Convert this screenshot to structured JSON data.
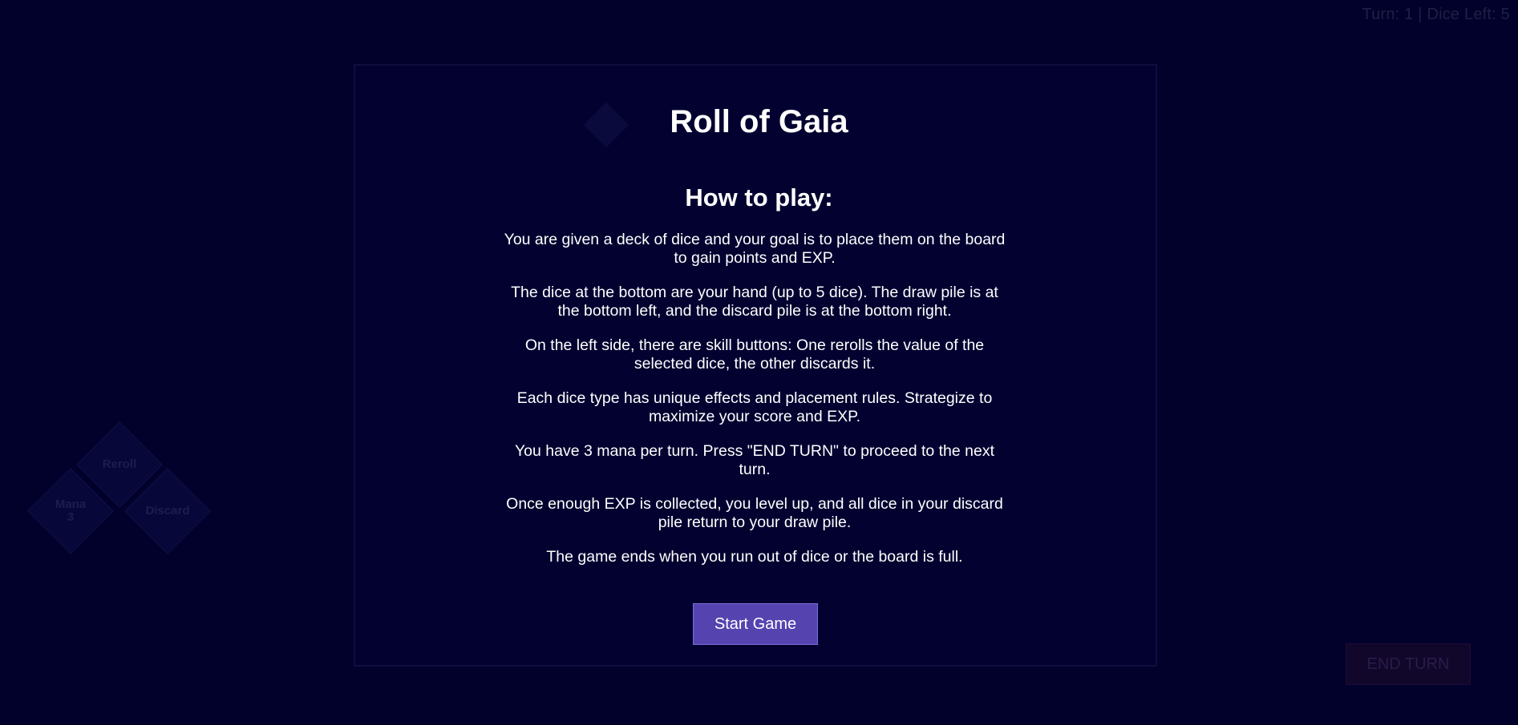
{
  "status": {
    "turn_label": "Turn: 1",
    "separator": "|",
    "dice_left_label": "Dice Left: 5"
  },
  "skills": {
    "reroll": "Reroll",
    "mana_label": "Mana",
    "mana_value": "3",
    "discard": "Discard"
  },
  "end_turn": "END TURN",
  "modal": {
    "title": "Roll of Gaia",
    "subtitle": "How to play:",
    "rules": [
      "You are given a deck of dice and your goal is to place them on the board to gain points and EXP.",
      "The dice at the bottom are your hand (up to 5 dice). The draw pile is at the bottom left, and the discard pile is at the bottom right.",
      "On the left side, there are skill buttons: One rerolls the value of the selected dice, the other discards it.",
      "Each dice type has unique effects and placement rules. Strategize to maximize your score and EXP.",
      "You have 3 mana per turn. Press \"END TURN\" to proceed to the next turn.",
      "Once enough EXP is collected, you level up, and all dice in your discard pile return to your draw pile.",
      "The game ends when you run out of dice or the board is full."
    ],
    "start_button": "Start Game"
  }
}
